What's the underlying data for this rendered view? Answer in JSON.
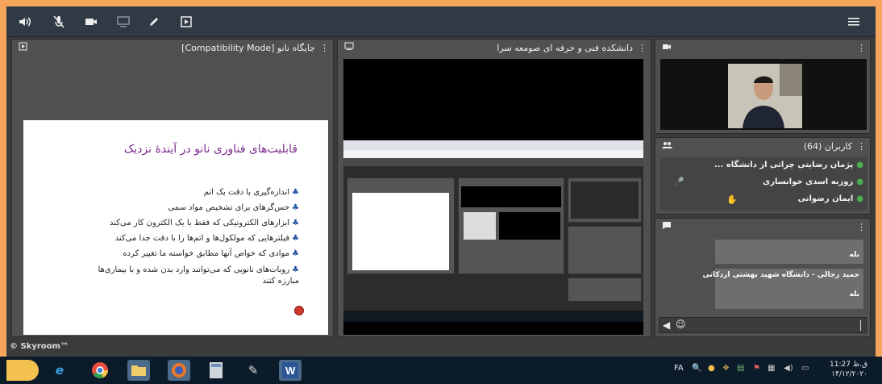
{
  "toolbar": {
    "icons": [
      "speaker-icon",
      "mic-muted-icon",
      "camera-icon",
      "screen-share-icon",
      "pen-icon",
      "present-icon",
      "menu-icon"
    ]
  },
  "presentation_panel": {
    "title": "جایگاه نانو [Compatibility Mode]",
    "slide": {
      "title": "قابلیت‌های فناوری نانو در آیندهٔ نزدیک",
      "bullets": [
        "اندازه‌گیری با دقت یک اتم",
        "حس‌گرهای برای تشخیص مواد سمی",
        "ابزارهای الکترونیکی که فقط با یک الکترون کار می‌کند",
        "فیلترهایی که مولکول‌ها و اتم‌ها را با دقت جدا می‌کند",
        "موادی که خواص آنها مطابق خواسته ما تغییر کرده",
        "روبات‌های نانویی که می‌توانند وارد بدن شده و با بیماری‌ها مبارزه کنند"
      ]
    }
  },
  "screen_panel": {
    "title": "دانشکده فنی و حرفه ای صومعه سرا"
  },
  "users_panel": {
    "title": "کاربران (64)",
    "users": [
      "پژمان رضایتی چراتی از دانشگاه ...",
      "روزبه اسدی خوانساری",
      "ایمان رضوانی"
    ]
  },
  "chat_panel": {
    "messages": [
      {
        "name": "",
        "text": "بله"
      },
      {
        "name": "حمید رجالی - دانشگاه شهید بهشتی اردکانی",
        "text": "بله"
      }
    ],
    "send_icon": "send-icon",
    "emoji_icon": "emoji-icon"
  },
  "brand": "© Skyroom™",
  "taskbar": {
    "apps": [
      "start-orb-icon",
      "ie-icon",
      "chrome-icon",
      "explorer-icon",
      "firefox-icon",
      "calculator-icon",
      "paint-icon",
      "word-icon"
    ],
    "lang": "FA",
    "clock_time": "11:27 ق.ظ",
    "clock_date": "۱۴/۱۲/۲۰۲۰"
  }
}
